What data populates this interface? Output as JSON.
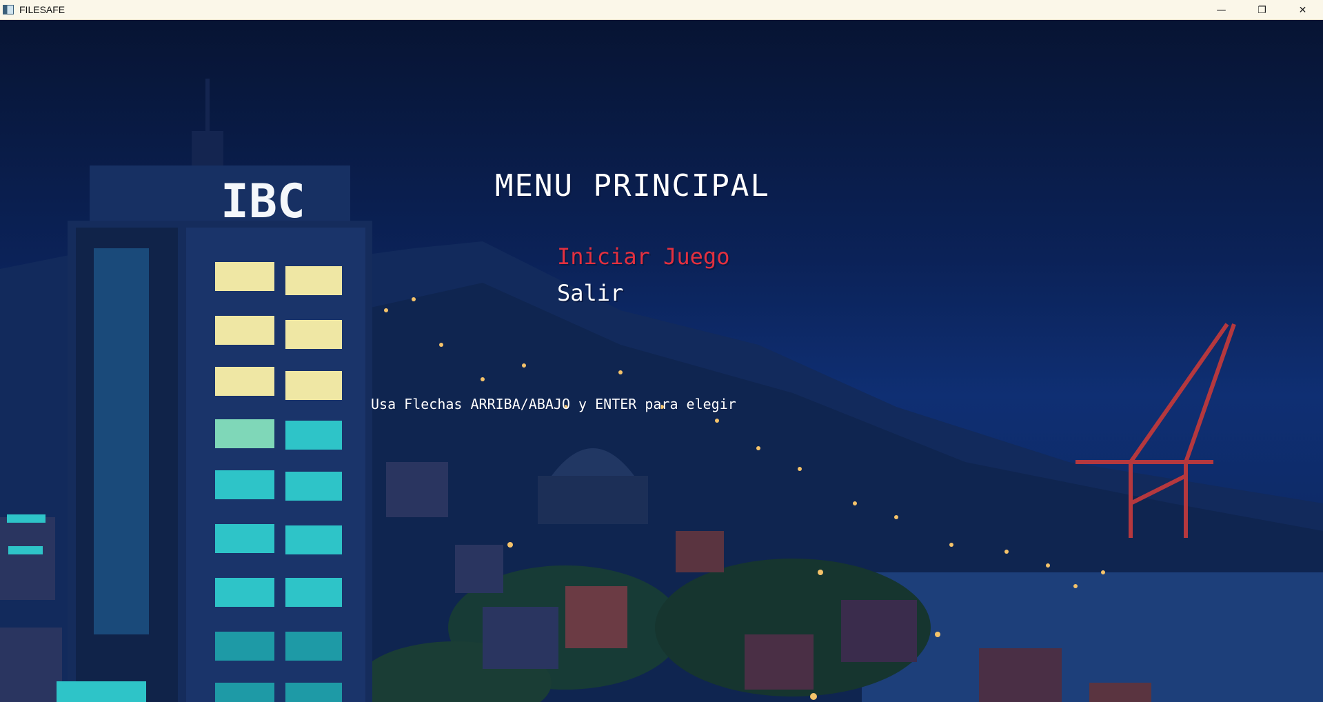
{
  "window": {
    "title": "FILESAFE",
    "controls": {
      "minimize": "—",
      "maximize": "❐",
      "close": "✕"
    }
  },
  "scene": {
    "building_sign": "IBC",
    "colors": {
      "sky_top": "#071433",
      "sky_mid": "#0f2f73",
      "lit_window_yellow": "#efe7a4",
      "lit_window_cyan": "#2ec4c8",
      "crane_red": "#b5383e"
    }
  },
  "menu": {
    "title": "MENU PRINCIPAL",
    "items": [
      {
        "label": "Iniciar Juego",
        "selected": true,
        "color": "#e3303f"
      },
      {
        "label": "Salir",
        "selected": false,
        "color": "#ffffff"
      }
    ],
    "hint": "Usa Flechas ARRIBA/ABAJO y ENTER para elegir"
  }
}
